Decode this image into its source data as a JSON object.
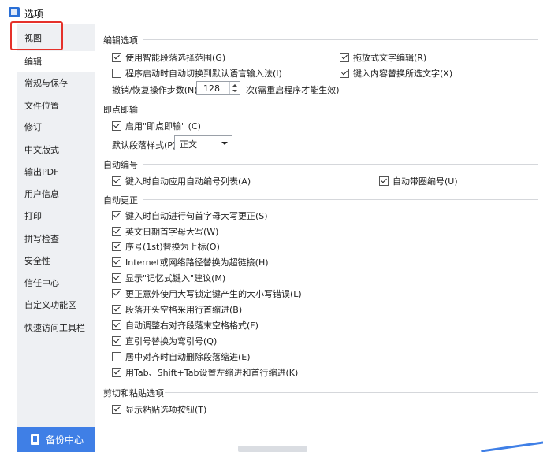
{
  "window": {
    "title": "选项"
  },
  "sidebar": {
    "items": [
      {
        "label": "视图"
      },
      {
        "label": "编辑"
      },
      {
        "label": "常规与保存"
      },
      {
        "label": "文件位置"
      },
      {
        "label": "修订"
      },
      {
        "label": "中文版式"
      },
      {
        "label": "输出PDF"
      },
      {
        "label": "用户信息"
      },
      {
        "label": "打印"
      },
      {
        "label": "拼写检查"
      },
      {
        "label": "安全性"
      },
      {
        "label": "信任中心"
      },
      {
        "label": "自定义功能区"
      },
      {
        "label": "快速访问工具栏"
      }
    ],
    "active": "编辑",
    "backup_label": "备份中心"
  },
  "edit_options": {
    "title": "编辑选项",
    "smart_paragraph": {
      "label": "使用智能段落选择范围(G)",
      "checked": true
    },
    "drag_text": {
      "label": "拖放式文字编辑(R)",
      "checked": true
    },
    "auto_switch_ime": {
      "label": "程序启动时自动切换到默认语言输入法(I)",
      "checked": false
    },
    "typing_replaces": {
      "label": "键入内容替换所选文字(X)",
      "checked": true
    },
    "undo_steps": {
      "label": "撤销/恢复操作步数(N):",
      "value": "128",
      "note": "次(需重启程序才能生效)"
    }
  },
  "click_type": {
    "title": "即点即输",
    "enable": {
      "label": "启用\"即点即输\" (C)",
      "checked": true
    },
    "default_style_label": "默认段落样式(P):",
    "default_style_value": "正文"
  },
  "auto_number": {
    "title": "自动编号",
    "auto_list": {
      "label": "键入时自动应用自动编号列表(A)",
      "checked": true
    },
    "auto_circle": {
      "label": "自动带圈编号(U)",
      "checked": true
    }
  },
  "auto_correct": {
    "title": "自动更正",
    "items": [
      {
        "label": "键入时自动进行句首字母大写更正(S)",
        "checked": true
      },
      {
        "label": "英文日期首字母大写(W)",
        "checked": true
      },
      {
        "label": "序号(1st)替换为上标(O)",
        "checked": true
      },
      {
        "label": "Internet或网络路径替换为超链接(H)",
        "checked": true
      },
      {
        "label": "显示\"记忆式键入\"建议(M)",
        "checked": true
      },
      {
        "label": "更正意外使用大写锁定键产生的大小写错误(L)",
        "checked": true
      },
      {
        "label": "段落开头空格采用行首缩进(B)",
        "checked": true
      },
      {
        "label": "自动调整右对齐段落末空格格式(F)",
        "checked": true
      },
      {
        "label": "直引号替换为弯引号(Q)",
        "checked": true
      },
      {
        "label": "居中对齐时自动删除段落缩进(E)",
        "checked": false
      },
      {
        "label": "用Tab、Shift+Tab设置左缩进和首行缩进(K)",
        "checked": true
      }
    ]
  },
  "cut_paste": {
    "title": "剪切和粘贴选项",
    "show_paste_button": {
      "label": "显示粘贴选项按钮(T)",
      "checked": true
    }
  },
  "colors": {
    "accent": "#3f7fe6",
    "highlight": "#e5312a",
    "sidebar_bg": "#eef0f3"
  }
}
